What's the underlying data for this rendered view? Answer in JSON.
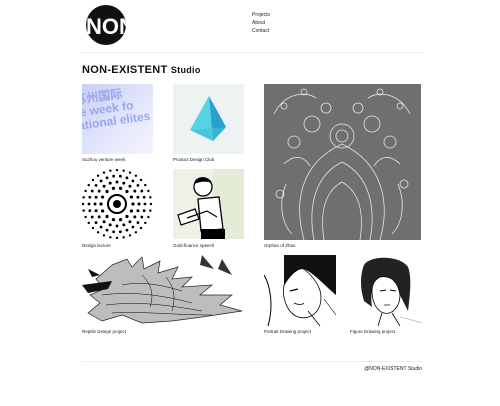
{
  "logo": {
    "text": "NON"
  },
  "nav": [
    "Projects",
    "About",
    "Contact"
  ],
  "heading": {
    "main": "NON-EXISTENT",
    "sub": "Studio"
  },
  "tiles": [
    {
      "caption": "Suzhou venture week",
      "art_text": "苏州国际\n e week fo\national elites in"
    },
    {
      "caption": "Product Design Club"
    },
    {
      "caption": "Orphan of Zhao"
    },
    {
      "caption": "Design lecture"
    },
    {
      "caption": "Gold-finance speech"
    },
    {
      "caption": "Reptile Design project"
    },
    {
      "caption": "Portrait Drawing project"
    },
    {
      "caption": "Figure Drawing project"
    }
  ],
  "footer": "@NON-EXISTENT Studio",
  "colors": {
    "text": "#111111",
    "divider": "#eeeeee",
    "teal": "#3fc3d6",
    "gray_tile": "#6f6f6f"
  }
}
